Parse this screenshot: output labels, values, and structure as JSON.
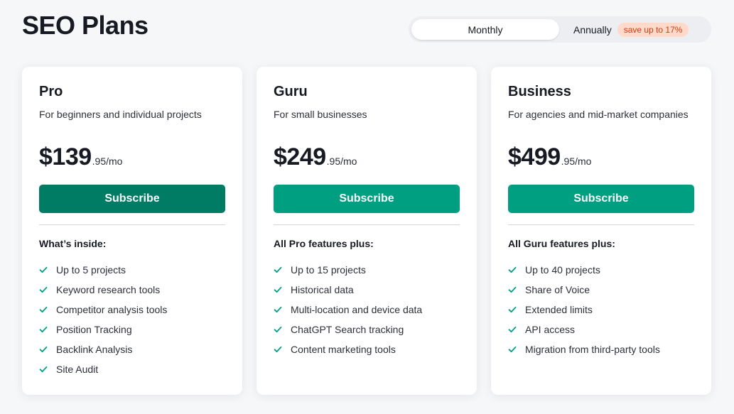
{
  "page": {
    "title": "SEO Plans"
  },
  "billing_toggle": {
    "monthly_label": "Monthly",
    "annually_label": "Annually",
    "save_badge": "save up to 17%",
    "selected": "Monthly"
  },
  "colors": {
    "primary_button": "#009f81",
    "primary_button_hover": "#007c65",
    "check": "#009f81",
    "save_badge_bg": "#ffd9c9",
    "save_badge_text": "#c93d14"
  },
  "plans": [
    {
      "name": "Pro",
      "description": "For beginners and individual projects",
      "price_main": "$139",
      "price_suffix": ".95/mo",
      "button_label": "Subscribe",
      "features_heading": "What’s inside:",
      "features": [
        "Up to 5 projects",
        "Keyword research tools",
        "Competitor analysis tools",
        "Position Tracking",
        "Backlink Analysis",
        "Site Audit"
      ]
    },
    {
      "name": "Guru",
      "description": "For small businesses",
      "price_main": "$249",
      "price_suffix": ".95/mo",
      "button_label": "Subscribe",
      "features_heading": "All Pro features plus:",
      "features": [
        "Up to 15 projects",
        "Historical data",
        "Multi-location and device data",
        "ChatGPT Search tracking",
        "Content marketing tools"
      ]
    },
    {
      "name": "Business",
      "description": "For agencies and mid-market companies",
      "price_main": "$499",
      "price_suffix": ".95/mo",
      "button_label": "Subscribe",
      "features_heading": "All Guru features plus:",
      "features": [
        "Up to 40 projects",
        "Share of Voice",
        "Extended limits",
        "API access",
        "Migration from third-party tools"
      ]
    }
  ]
}
